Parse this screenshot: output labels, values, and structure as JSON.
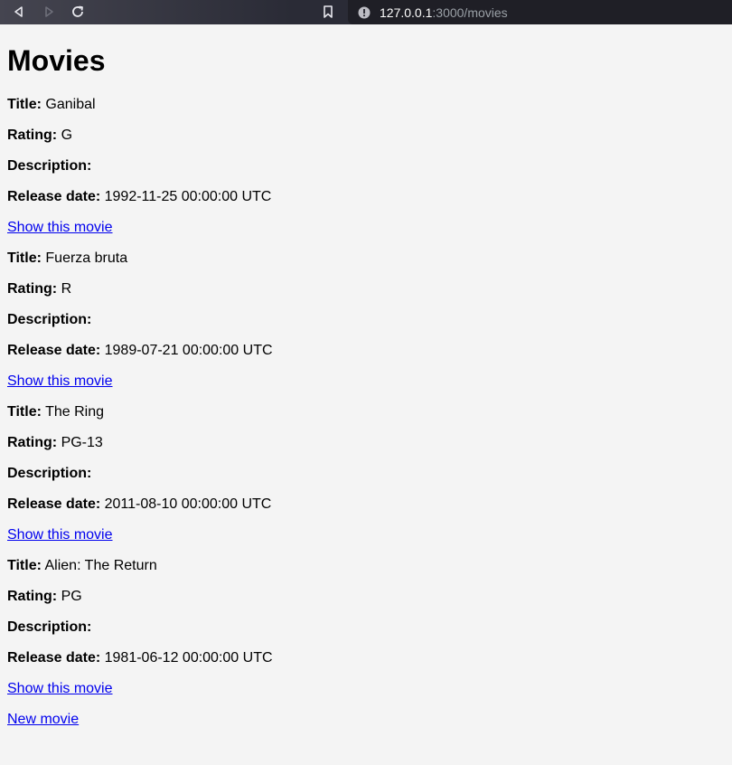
{
  "browser": {
    "url_host": "127.0.0.1",
    "url_path": ":3000/movies"
  },
  "page": {
    "heading": "Movies",
    "labels": {
      "title": "Title:",
      "rating": "Rating:",
      "description": "Description:",
      "release_date": "Release date:"
    },
    "show_link_label": "Show this movie",
    "new_movie_label": "New movie"
  },
  "movies": [
    {
      "title": "Ganibal",
      "rating": "G",
      "description": "",
      "release_date": "1992-11-25 00:00:00 UTC"
    },
    {
      "title": "Fuerza bruta",
      "rating": "R",
      "description": "",
      "release_date": "1989-07-21 00:00:00 UTC"
    },
    {
      "title": "The Ring",
      "rating": "PG-13",
      "description": "",
      "release_date": "2011-08-10 00:00:00 UTC"
    },
    {
      "title": "Alien: The Return",
      "rating": "PG",
      "description": "",
      "release_date": "1981-06-12 00:00:00 UTC"
    }
  ],
  "icons": {
    "back": "back-arrow-icon",
    "forward": "forward-arrow-icon",
    "reload": "reload-icon",
    "bookmark": "bookmark-icon",
    "site_info": "site-info-icon"
  }
}
